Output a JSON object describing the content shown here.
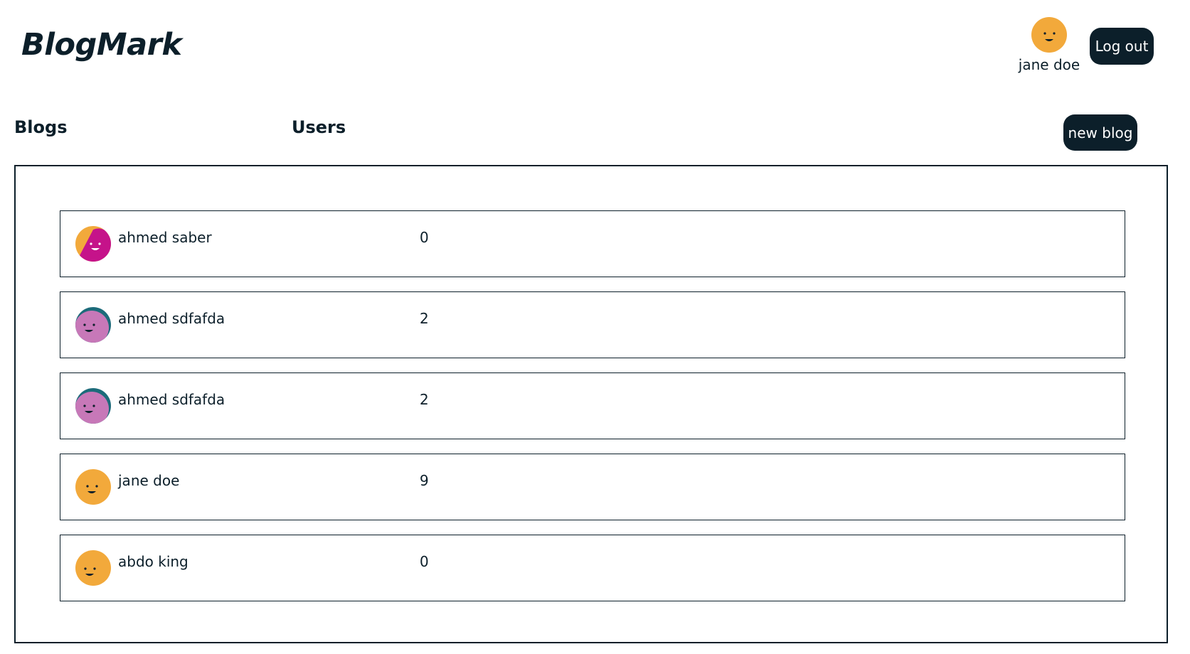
{
  "app": {
    "title": "BlogMark"
  },
  "header": {
    "current_user": {
      "name": "jane doe",
      "avatar": "orange-smiley-icon"
    },
    "logout_label": "Log out"
  },
  "nav": {
    "blogs_label": "Blogs",
    "users_label": "Users"
  },
  "toolbar": {
    "new_blog_label": "new blog"
  },
  "colors": {
    "primary": "#0c1f2a",
    "avatar_orange": "#f2a93b",
    "avatar_magenta": "#c5138a",
    "avatar_pink": "#c778b8",
    "avatar_teal": "#1c6b7a"
  },
  "users": [
    {
      "name": "ahmed saber",
      "blogs": "0",
      "avatar": "orange-magenta-smiley-icon"
    },
    {
      "name": "ahmed sdfafda",
      "blogs": "2",
      "avatar": "pink-teal-smiley-icon"
    },
    {
      "name": "ahmed sdfafda",
      "blogs": "2",
      "avatar": "pink-teal-smiley-icon"
    },
    {
      "name": "jane doe",
      "blogs": "9",
      "avatar": "orange-smiley-icon"
    },
    {
      "name": "abdo king",
      "blogs": "0",
      "avatar": "orange-smiley-icon"
    }
  ]
}
